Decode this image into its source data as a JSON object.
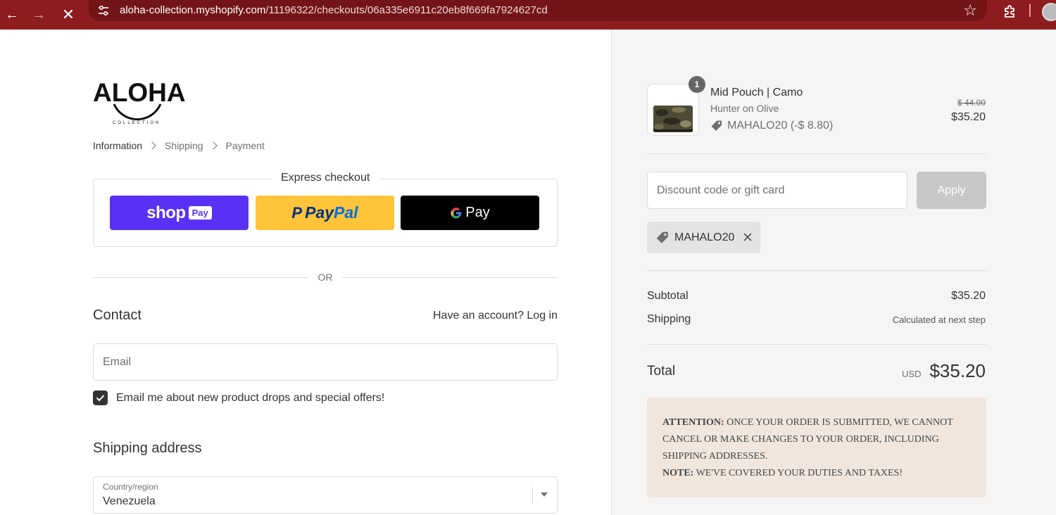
{
  "browser": {
    "url_host": "aloha-collection.myshopify.com",
    "url_path": "/11196322/checkouts/06a335e6911c20eb8f669fa7924627cd"
  },
  "brand": {
    "logo_text": "ALOHA",
    "logo_sub": "COLLECTION"
  },
  "breadcrumb": [
    "Information",
    "Shipping",
    "Payment"
  ],
  "express": {
    "title": "Express checkout",
    "shop_word": "shop",
    "shop_pay": "Pay",
    "paypal_pay": "Pay",
    "paypal_pal": "Pal",
    "gpay": "Pay"
  },
  "divider_or": "OR",
  "contact": {
    "heading": "Contact",
    "login": "Have an account? Log in",
    "email_placeholder": "Email",
    "optin_label": "Email me about new product drops and special offers!",
    "optin_checked": true
  },
  "shipping": {
    "heading": "Shipping address",
    "country_label": "Country/region",
    "country_value": "Venezuela"
  },
  "cart": {
    "quantity": "1",
    "name": "Mid Pouch | Camo",
    "variant": "Hunter on Olive",
    "discount_line": "MAHALO20 (-$ 8.80)",
    "original_price": "$ 44.00",
    "price": "$35.20"
  },
  "discount": {
    "placeholder": "Discount code or gift card",
    "apply_label": "Apply",
    "applied_code": "MAHALO20"
  },
  "summary": {
    "subtotal_label": "Subtotal",
    "subtotal_value": "$35.20",
    "shipping_label": "Shipping",
    "shipping_value": "Calculated at next step",
    "total_label": "Total",
    "currency": "USD",
    "total_value": "$35.20"
  },
  "notice": {
    "attention_label": "ATTENTION:",
    "attention_text": "ONCE YOUR ORDER IS SUBMITTED, WE CANNOT CANCEL OR MAKE CHANGES TO YOUR ORDER, INCLUDING SHIPPING ADDRESSES.",
    "note_label": "NOTE:",
    "note_text": "WE'VE COVERED YOUR DUTIES AND TAXES!"
  },
  "colors": {
    "chrome": "#8e1b1e",
    "shop_pay": "#5a31f4",
    "paypal": "#ffc439",
    "gpay": "#000000",
    "notice_bg": "#f0e6de"
  }
}
